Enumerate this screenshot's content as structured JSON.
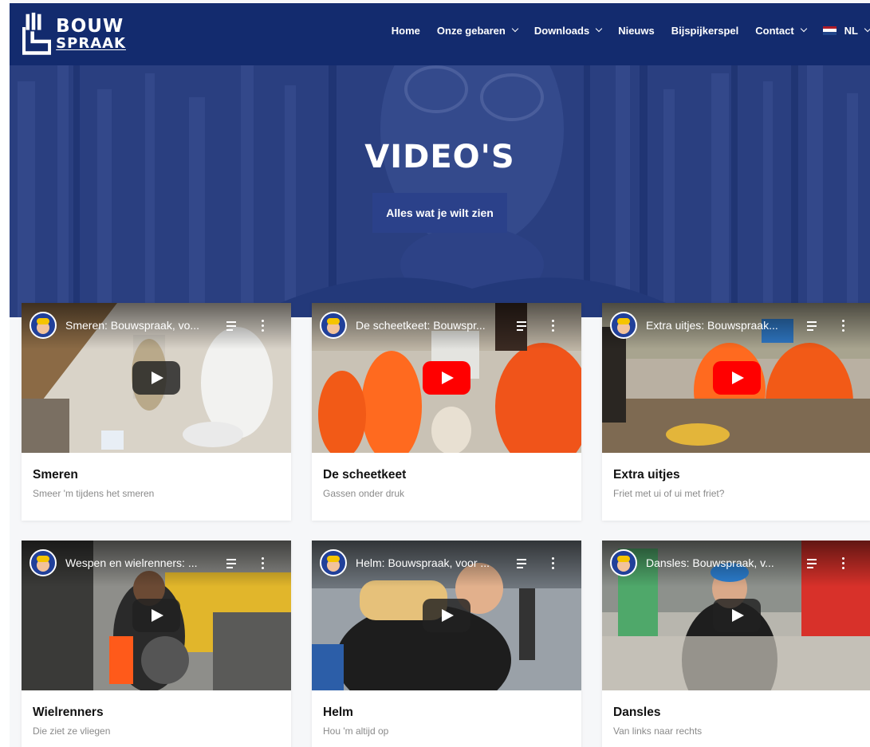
{
  "brand": {
    "logo_line1": "BOUW",
    "logo_line2": "SPRAAK"
  },
  "nav": {
    "items": [
      {
        "label": "Home",
        "dropdown": false
      },
      {
        "label": "Onze gebaren",
        "dropdown": true
      },
      {
        "label": "Downloads",
        "dropdown": true
      },
      {
        "label": "Nieuws",
        "dropdown": false
      },
      {
        "label": "Bijspijkerspel",
        "dropdown": false
      },
      {
        "label": "Contact",
        "dropdown": true
      }
    ],
    "language": "NL",
    "language_icon": "dutch-flag-icon"
  },
  "hero": {
    "title": "VIDEO'S",
    "subtitle": "Alles wat je wilt zien"
  },
  "videos": [
    {
      "yt_title": "Smeren: Bouwspraak, vo...",
      "title": "Smeren",
      "subtitle": "Smeer 'm tijdens het smeren",
      "play_style": "dark"
    },
    {
      "yt_title": "De scheetkeet: Bouwspr...",
      "title": "De scheetkeet",
      "subtitle": "Gassen onder druk",
      "play_style": "red"
    },
    {
      "yt_title": "Extra uitjes: Bouwspraak...",
      "title": "Extra uitjes",
      "subtitle": "Friet met ui of ui met friet?",
      "play_style": "red"
    },
    {
      "yt_title": "Wespen en wielrenners: ...",
      "title": "Wielrenners",
      "subtitle": "Die ziet ze vliegen",
      "play_style": "dark"
    },
    {
      "yt_title": "Helm: Bouwspraak, voor ...",
      "title": "Helm",
      "subtitle": "Hou 'm altijd op",
      "play_style": "dark"
    },
    {
      "yt_title": "Dansles: Bouwspraak, v...",
      "title": "Dansles",
      "subtitle": "Van links naar rechts",
      "play_style": "dark"
    }
  ],
  "colors": {
    "header_bg": "#132b6e",
    "hero_overlay": "#263b7c",
    "yt_red": "#ff0000"
  }
}
